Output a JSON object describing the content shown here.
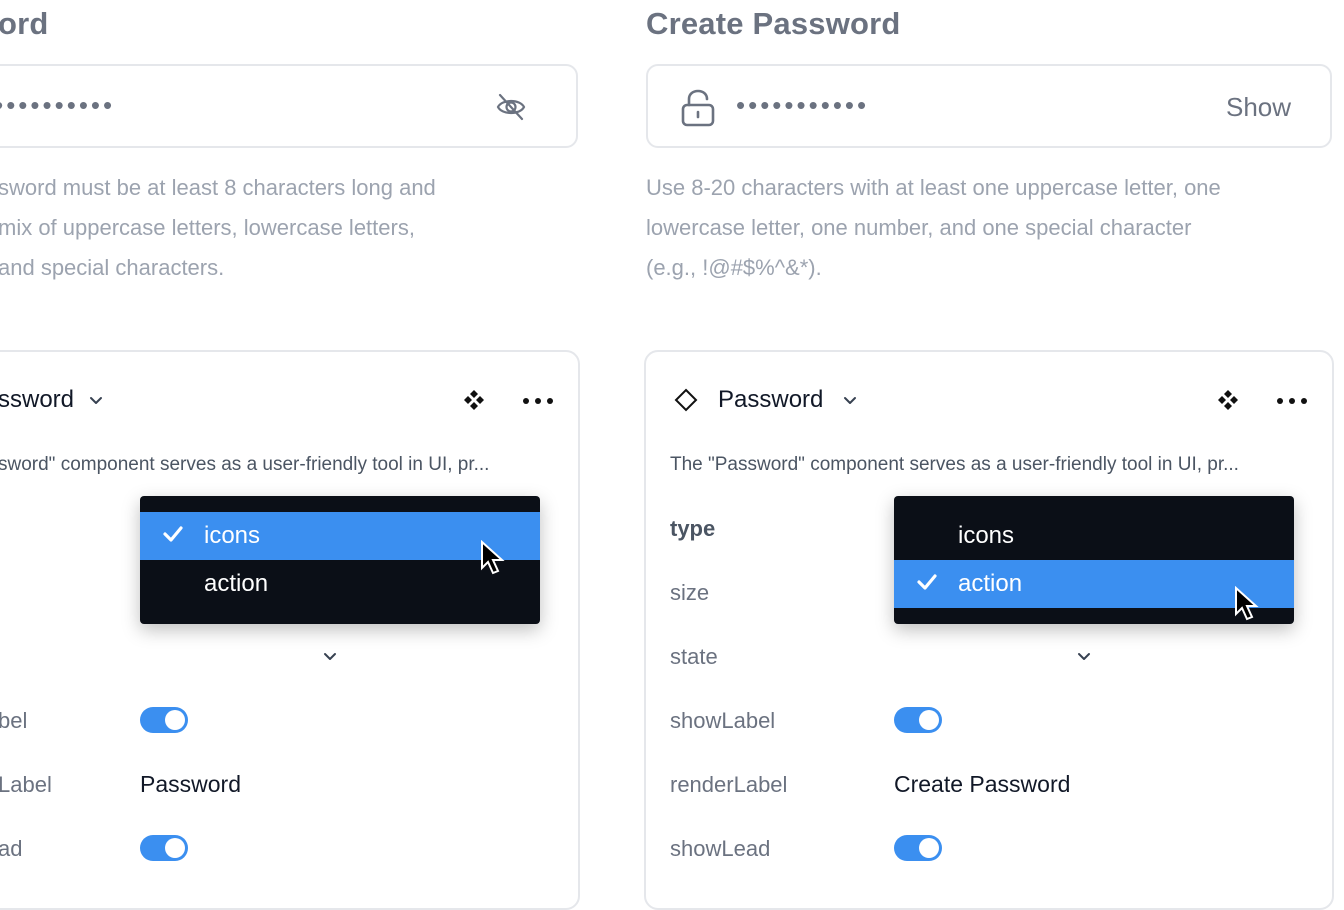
{
  "left": {
    "title": "ord",
    "password_mask": "•••••••••••",
    "hint_lines": [
      "sword must be at least 8 characters long and",
      "mix of uppercase letters, lowercase letters,",
      " and special characters."
    ],
    "component_name": "ssword",
    "description": "sword\" component serves as a user-friendly tool in UI, pr...",
    "dropdown": {
      "options": [
        "icons",
        "action"
      ],
      "selected": "icons"
    },
    "props": [
      {
        "label": "bel",
        "value_type": "toggle"
      },
      {
        "label": "Label",
        "value": "Password"
      },
      {
        "label": "ad",
        "value_type": "toggle"
      }
    ]
  },
  "right": {
    "title": "Create Password",
    "password_mask": "•••••••••••",
    "show_label": "Show",
    "hint_lines": [
      "Use 8-20 characters with at least one uppercase letter, one",
      "lowercase letter, one number, and one special character",
      "(e.g., !@#$%^&*)."
    ],
    "component_name": "Password",
    "description": "The \"Password\" component serves as a user-friendly tool in UI, pr...",
    "dropdown": {
      "options": [
        "icons",
        "action"
      ],
      "selected": "action"
    },
    "props": [
      {
        "label": "type"
      },
      {
        "label": "size"
      },
      {
        "label": "state"
      },
      {
        "label": "showLabel",
        "value_type": "toggle"
      },
      {
        "label": "renderLabel",
        "value": "Create Password"
      },
      {
        "label": "showLead",
        "value_type": "toggle"
      }
    ]
  },
  "colors": {
    "accent": "#3b8ff0",
    "dropdown_bg": "#0b0f17",
    "muted_text": "#9ca3af"
  },
  "icons": [
    "eye-off-icon",
    "lock-icon",
    "diamond-icon",
    "chevron-down-icon",
    "component-icon",
    "more-icon",
    "check-icon",
    "cursor-icon"
  ]
}
